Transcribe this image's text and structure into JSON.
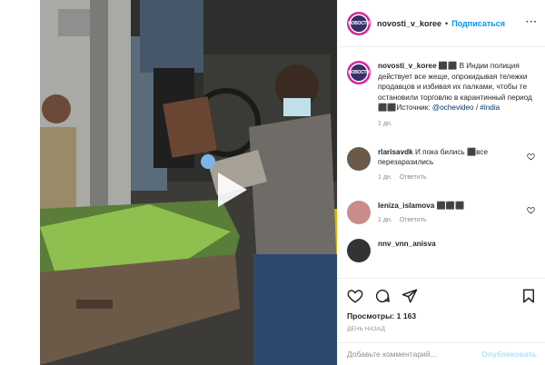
{
  "header": {
    "username": "novosti_v_koree",
    "separator": "•",
    "follow_label": "Подписаться",
    "more_label": "···",
    "avatar_text": "НОВОСТИ"
  },
  "caption": {
    "username": "novosti_v_koree",
    "text": " ⬛⬛ В Индии полиция действует все жеще, опрокидывая тележки продавцов и избивая их палками, чтобы те остановили торговлю в карантинный период ⬛⬛Источник: ",
    "source_link": "@ochevideo",
    "link_separator": " / ",
    "hashtag": "#india",
    "time": "1 дн."
  },
  "comments": [
    {
      "username": "rlarisavdk",
      "text": " И пока бились ⬛все перезаразились",
      "time": "1 дн.",
      "reply_label": "Ответить",
      "avatar_color": "#6b5a4a"
    },
    {
      "username": "leniza_islamova",
      "text": " ⬛⬛⬛",
      "time": "1 дн.",
      "reply_label": "Ответить",
      "avatar_color": "#c98b8b"
    },
    {
      "username": "nnv_vnn_anisva",
      "text": "",
      "time": "",
      "reply_label": "",
      "avatar_color": "#333333"
    }
  ],
  "actions": {
    "like_icon": "heart-icon",
    "comment_icon": "comment-icon",
    "share_icon": "share-icon",
    "save_icon": "bookmark-icon",
    "views_label": "Просмотры:",
    "views_count": "1 163",
    "date": "день назад"
  },
  "add_comment": {
    "placeholder": "Добавьте комментарий...",
    "post_label": "Опубликовать"
  },
  "video": {
    "play_icon": "play-icon"
  }
}
